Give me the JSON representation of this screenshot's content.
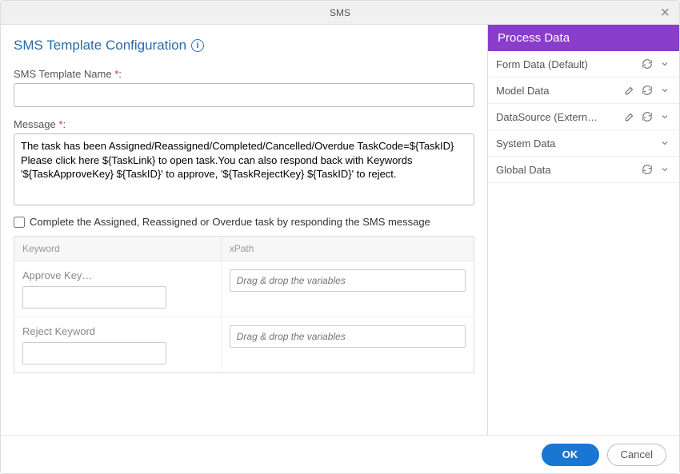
{
  "dialog": {
    "title": "SMS",
    "close_symbol": "×"
  },
  "main": {
    "heading": "SMS Template Configuration",
    "name_label": "SMS Template Name ",
    "name_value": "",
    "message_label": "Message ",
    "message_value": "The task has been Assigned/Reassigned/Completed/Cancelled/Overdue TaskCode=${TaskID} Please click here ${TaskLink} to open task.You can also respond back with Keywords '${TaskApproveKey} ${TaskID}' to approve, '${TaskRejectKey} ${TaskID}' to reject.",
    "checkbox_label": "Complete the Assigned, Reassigned or Overdue task by responding the SMS message",
    "checkbox_checked": false,
    "table": {
      "col_keyword": "Keyword",
      "col_xpath": "xPath",
      "rows": [
        {
          "kw_label": "Approve Key…",
          "kw_value": "",
          "drop_placeholder": "Drag & drop the variables"
        },
        {
          "kw_label": "Reject Keyword",
          "kw_value": "",
          "drop_placeholder": "Drag & drop the variables"
        }
      ]
    }
  },
  "sidepanel": {
    "header": "Process Data",
    "items": [
      {
        "label": "Form Data (Default)",
        "edit": false,
        "refresh": true,
        "expand": true
      },
      {
        "label": "Model Data",
        "edit": true,
        "refresh": true,
        "expand": true
      },
      {
        "label": "DataSource (Extern…",
        "edit": true,
        "refresh": true,
        "expand": true
      },
      {
        "label": "System Data",
        "edit": false,
        "refresh": false,
        "expand": true
      },
      {
        "label": "Global Data",
        "edit": false,
        "refresh": true,
        "expand": true
      }
    ]
  },
  "footer": {
    "ok": "OK",
    "cancel": "Cancel"
  },
  "required_marker": "*"
}
